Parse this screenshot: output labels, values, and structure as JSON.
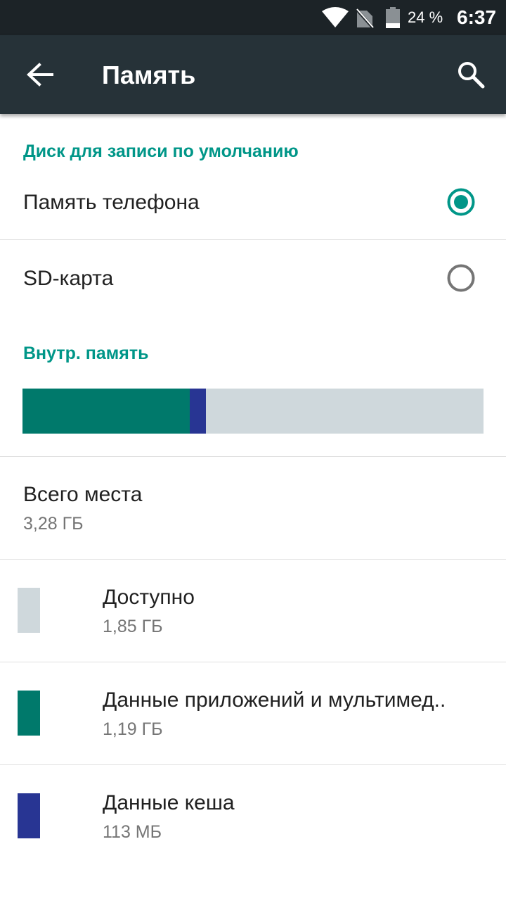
{
  "status_bar": {
    "battery_percent": "24 %",
    "time": "6:37",
    "icons": [
      "wifi-icon",
      "no-sim-icon",
      "battery-icon"
    ]
  },
  "toolbar": {
    "title": "Память",
    "back_icon": "arrow-left-icon",
    "search_icon": "search-icon"
  },
  "default_disk": {
    "header": "Диск для записи по умолчанию",
    "options": [
      {
        "label": "Память телефона",
        "selected": true
      },
      {
        "label": "SD-карта",
        "selected": false
      }
    ]
  },
  "internal": {
    "header": "Внутр. память",
    "usage_bar": {
      "segments": [
        {
          "name": "Данные приложений и мультимед..",
          "value_gb": 1.19,
          "color": "#00796b"
        },
        {
          "name": "Данные кеша",
          "value_gb": 0.113,
          "color": "#283593"
        },
        {
          "name": "Доступно",
          "value_gb": 1.85,
          "color": "#cfd8dc"
        }
      ],
      "total_gb": 3.28
    },
    "total": {
      "title": "Всего места",
      "value": "3,28 ГБ"
    },
    "items": [
      {
        "title": "Доступно",
        "value": "1,85 ГБ",
        "color": "#cfd8dc"
      },
      {
        "title": "Данные приложений и мультимед..",
        "value": "1,19 ГБ",
        "color": "#00796b"
      },
      {
        "title": "Данные кеша",
        "value": "113 МБ",
        "color": "#283593"
      }
    ]
  },
  "colors": {
    "accent": "#009688",
    "toolbar": "#263238",
    "statusbar": "#1c2327",
    "radio_unchecked": "#757575"
  }
}
